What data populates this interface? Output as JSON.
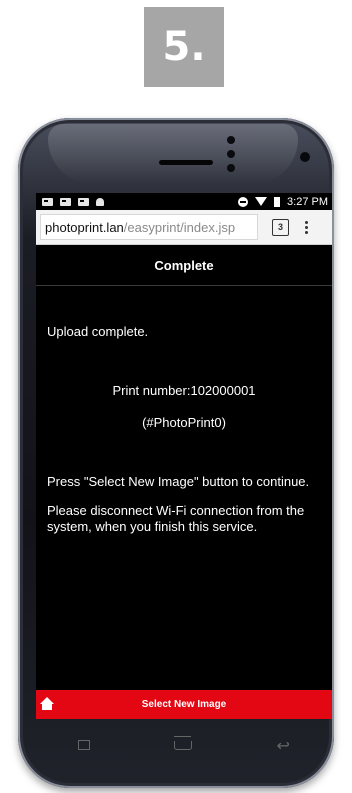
{
  "step": {
    "label": "5."
  },
  "status_bar": {
    "time": "3:27 PM"
  },
  "browser": {
    "url_host": "photoprint.lan",
    "url_path": "/easyprint/index.jsp",
    "tab_count": "3"
  },
  "page": {
    "header": "Complete",
    "upload_message": "Upload complete.",
    "print_number": "Print number:102000001",
    "print_tag": "(#PhotoPrint0)",
    "continue_message": "Press \"Select New Image\" button to continue.",
    "disconnect_message": "Please disconnect Wi-Fi connection from the system, when you finish this service.",
    "select_button": "Select New Image"
  },
  "icons": {
    "home": "home-icon",
    "tabs": "tab-switcher-icon",
    "menu": "overflow-menu-icon",
    "back": "back-icon",
    "recents": "recent-apps-icon"
  },
  "colors": {
    "step_badge": "#a6a6a6",
    "screen_bg": "#000000",
    "accent_red": "#e30613"
  }
}
